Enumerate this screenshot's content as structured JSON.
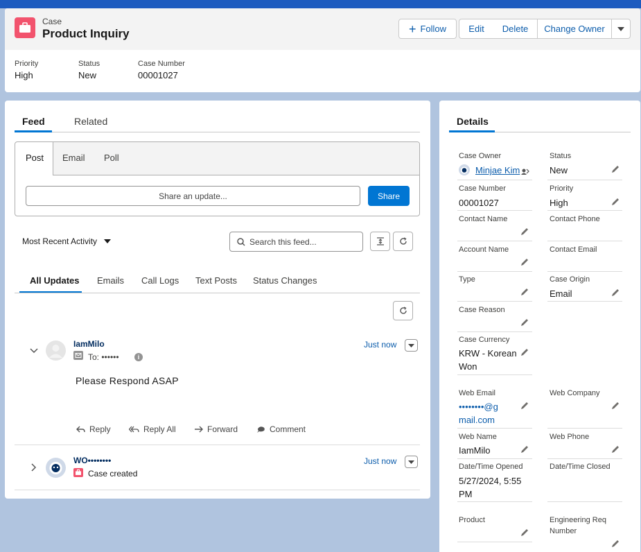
{
  "header": {
    "object_type": "Case",
    "title": "Product Inquiry",
    "buttons": {
      "follow": "Follow",
      "edit": "Edit",
      "delete": "Delete",
      "change_owner": "Change Owner"
    },
    "fields": [
      {
        "label": "Priority",
        "value": "High"
      },
      {
        "label": "Status",
        "value": "New"
      },
      {
        "label": "Case Number",
        "value": "00001027"
      }
    ]
  },
  "feed": {
    "tabs": {
      "feed": "Feed",
      "related": "Related"
    },
    "publisher_tabs": {
      "post": "Post",
      "email": "Email",
      "poll": "Poll"
    },
    "share_placeholder": "Share an update...",
    "share_button": "Share",
    "sort_label": "Most Recent Activity",
    "search_placeholder": "Search this feed...",
    "filter_tabs": {
      "all": "All Updates",
      "emails": "Emails",
      "call_logs": "Call Logs",
      "text_posts": "Text Posts",
      "status_changes": "Status Changes"
    },
    "items": [
      {
        "author": "IamMilo",
        "to": "To: ••••••",
        "time": "Just now",
        "body": "Please Respond ASAP",
        "actions": {
          "reply": "Reply",
          "reply_all": "Reply All",
          "forward": "Forward",
          "comment": "Comment"
        }
      },
      {
        "author": "WO••••••••",
        "time": "Just now",
        "sub": "Case created"
      }
    ]
  },
  "details": {
    "tab": "Details",
    "fields": {
      "case_owner": {
        "label": "Case Owner",
        "value": "Minjae Kim"
      },
      "status": {
        "label": "Status",
        "value": "New"
      },
      "case_number": {
        "label": "Case Number",
        "value": "00001027"
      },
      "priority": {
        "label": "Priority",
        "value": "High"
      },
      "contact_name": {
        "label": "Contact Name",
        "value": ""
      },
      "contact_phone": {
        "label": "Contact Phone",
        "value": ""
      },
      "account_name": {
        "label": "Account Name",
        "value": ""
      },
      "contact_email": {
        "label": "Contact Email",
        "value": ""
      },
      "type": {
        "label": "Type",
        "value": ""
      },
      "case_origin": {
        "label": "Case Origin",
        "value": "Email"
      },
      "case_reason": {
        "label": "Case Reason",
        "value": ""
      },
      "case_currency": {
        "label": "Case Currency",
        "value_line1": "KRW - Korean",
        "value_line2": "Won"
      },
      "web_email": {
        "label": "Web Email",
        "value_line1": "••••••••@g",
        "value_line2": "mail.com"
      },
      "web_company": {
        "label": "Web Company",
        "value": ""
      },
      "web_name": {
        "label": "Web Name",
        "value": "IamMilo"
      },
      "web_phone": {
        "label": "Web Phone",
        "value": ""
      },
      "date_opened": {
        "label": "Date/Time Opened",
        "value_line1": "5/27/2024, 5:55",
        "value_line2": "PM"
      },
      "date_closed": {
        "label": "Date/Time Closed",
        "value": ""
      },
      "product": {
        "label": "Product",
        "value": ""
      },
      "eng_req": {
        "label_line1": "Engineering Req",
        "label_line2": "Number",
        "value": ""
      }
    }
  },
  "colors": {
    "brand_blue": "#0176d3",
    "case_icon": "#f2536d",
    "link": "#0b5cab"
  }
}
